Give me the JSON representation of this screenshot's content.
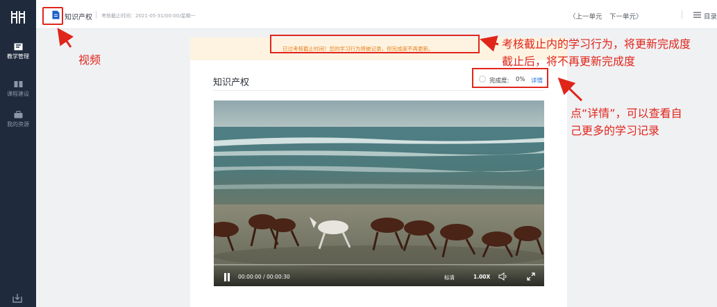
{
  "sidebar": {
    "logo_icon": "grid-logo-icon",
    "items": [
      {
        "label": "教学管理",
        "icon": "book-icon",
        "active": true
      },
      {
        "label": "课程建设",
        "icon": "open-book-icon",
        "active": false
      },
      {
        "label": "我的资源",
        "icon": "briefcase-icon",
        "active": false
      }
    ],
    "export_icon": "export-icon"
  },
  "topbar": {
    "doc_icon": "document-icon",
    "title": "知识产权",
    "deadline": "考核截止时间：2021-05-31/00:00/星期一",
    "prev_label": "〈上一单元",
    "next_label": "下一单元〉",
    "catalog_label": "目录",
    "menu_icon": "menu-icon"
  },
  "notice": {
    "text": "已过考核截止时间！您的学习行为将被记录，但完成度不再更新。"
  },
  "lesson": {
    "title": "知识产权",
    "progress_label": "完成度:",
    "progress_value": "0%",
    "progress_fraction": 0,
    "details_label": "详情"
  },
  "video": {
    "time": "00:00:00 / 00:00:30",
    "quality": "标清",
    "speed": "1.00X",
    "played_fraction": 0
  },
  "annotations": {
    "video": "视频",
    "deadline_line1": "考核截止内的学习行为，将更新完成度",
    "deadline_line2": "截止后，将不再更新完成度",
    "details_line1": "点“详情”，可以查看自",
    "details_line2": "己更多的学习记录"
  },
  "colors": {
    "sidebar_bg": "#1f2a3d",
    "annotation_red": "#e0251b",
    "notice_orange": "#e8811e",
    "link_blue": "#2b76e5"
  }
}
